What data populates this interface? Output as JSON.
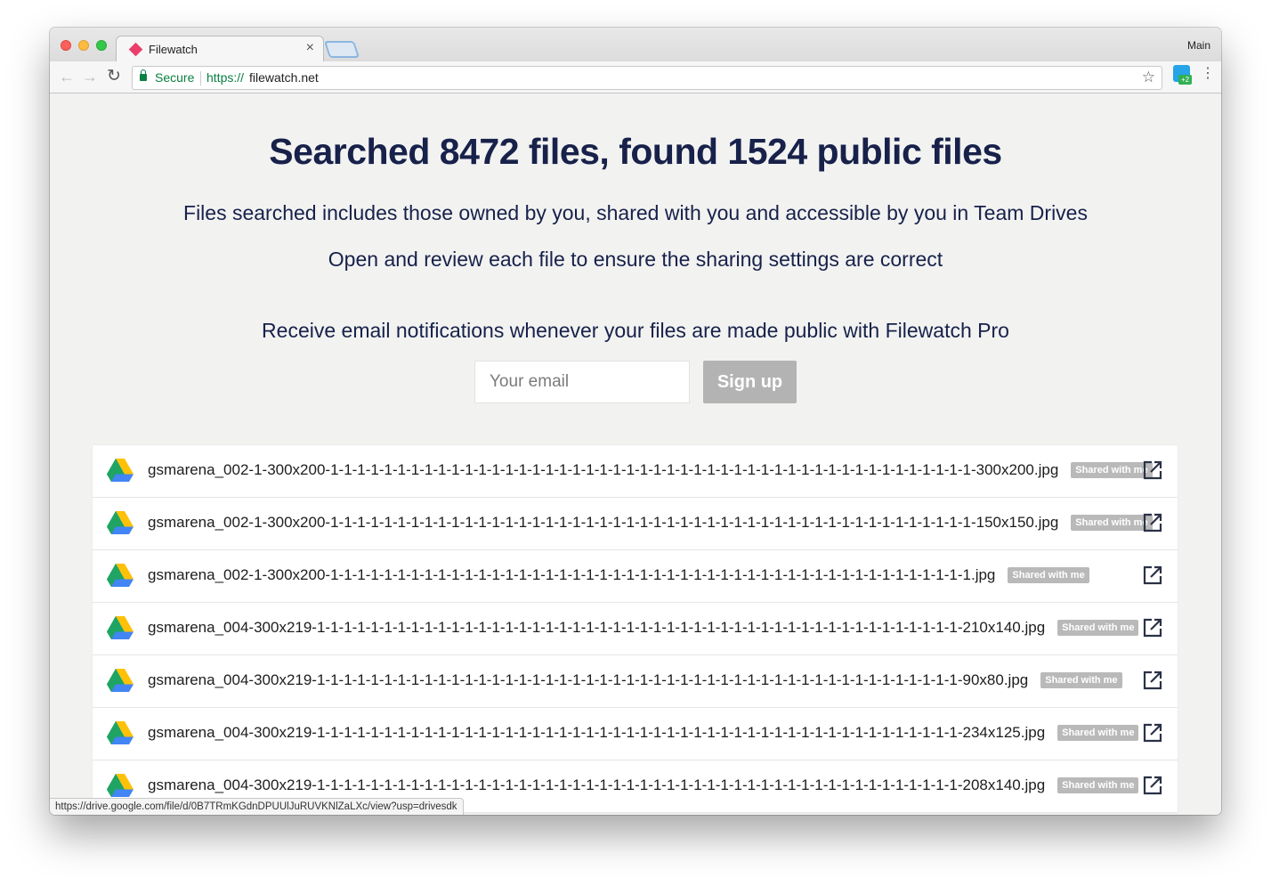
{
  "browser": {
    "tab_title": "Filewatch",
    "tab_close": "×",
    "profile": "Main",
    "secure_label": "Secure",
    "url_scheme": "https://",
    "url_host": "filewatch.net",
    "extension_badge": "+2",
    "status_url": "https://drive.google.com/file/d/0B7TRmKGdnDPUUlJuRUVKNlZaLXc/view?usp=drivesdk"
  },
  "page": {
    "headline": "Searched 8472 files, found 1524 public files",
    "subtitle1": "Files searched includes those owned by you, shared with you and accessible by you in Team Drives",
    "subtitle2": "Open and review each file to ensure the sharing settings are correct",
    "pro_prompt": "Receive email notifications whenever your files are made public with Filewatch Pro",
    "email_placeholder": "Your email",
    "signup_label": "Sign up"
  },
  "files": [
    {
      "name": "gsmarena_002-1-300x200-1-1-1-1-1-1-1-1-1-1-1-1-1-1-1-1-1-1-1-1-1-1-1-1-1-1-1-1-1-1-1-1-1-1-1-1-1-1-1-1-1-1-1-1-1-1-1-1-300x200.jpg",
      "badge": "Shared with me"
    },
    {
      "name": "gsmarena_002-1-300x200-1-1-1-1-1-1-1-1-1-1-1-1-1-1-1-1-1-1-1-1-1-1-1-1-1-1-1-1-1-1-1-1-1-1-1-1-1-1-1-1-1-1-1-1-1-1-1-1-150x150.jpg",
      "badge": "Shared with me"
    },
    {
      "name": "gsmarena_002-1-300x200-1-1-1-1-1-1-1-1-1-1-1-1-1-1-1-1-1-1-1-1-1-1-1-1-1-1-1-1-1-1-1-1-1-1-1-1-1-1-1-1-1-1-1-1-1-1-1-1.jpg",
      "badge": "Shared with me"
    },
    {
      "name": "gsmarena_004-300x219-1-1-1-1-1-1-1-1-1-1-1-1-1-1-1-1-1-1-1-1-1-1-1-1-1-1-1-1-1-1-1-1-1-1-1-1-1-1-1-1-1-1-1-1-1-1-1-1-210x140.jpg",
      "badge": "Shared with me"
    },
    {
      "name": "gsmarena_004-300x219-1-1-1-1-1-1-1-1-1-1-1-1-1-1-1-1-1-1-1-1-1-1-1-1-1-1-1-1-1-1-1-1-1-1-1-1-1-1-1-1-1-1-1-1-1-1-1-1-90x80.jpg",
      "badge": "Shared with me"
    },
    {
      "name": "gsmarena_004-300x219-1-1-1-1-1-1-1-1-1-1-1-1-1-1-1-1-1-1-1-1-1-1-1-1-1-1-1-1-1-1-1-1-1-1-1-1-1-1-1-1-1-1-1-1-1-1-1-1-234x125.jpg",
      "badge": "Shared with me"
    },
    {
      "name": "gsmarena_004-300x219-1-1-1-1-1-1-1-1-1-1-1-1-1-1-1-1-1-1-1-1-1-1-1-1-1-1-1-1-1-1-1-1-1-1-1-1-1-1-1-1-1-1-1-1-1-1-1-1-208x140.jpg",
      "badge": "Shared with me"
    }
  ],
  "icons": {
    "file_icon": "google-drive-icon",
    "open_icon": "open-external-icon"
  },
  "colors": {
    "heading": "#17214a",
    "secure_green": "#0b8043",
    "button_disabled": "#b3b3b3",
    "badge_gray": "#b9b9b9"
  }
}
